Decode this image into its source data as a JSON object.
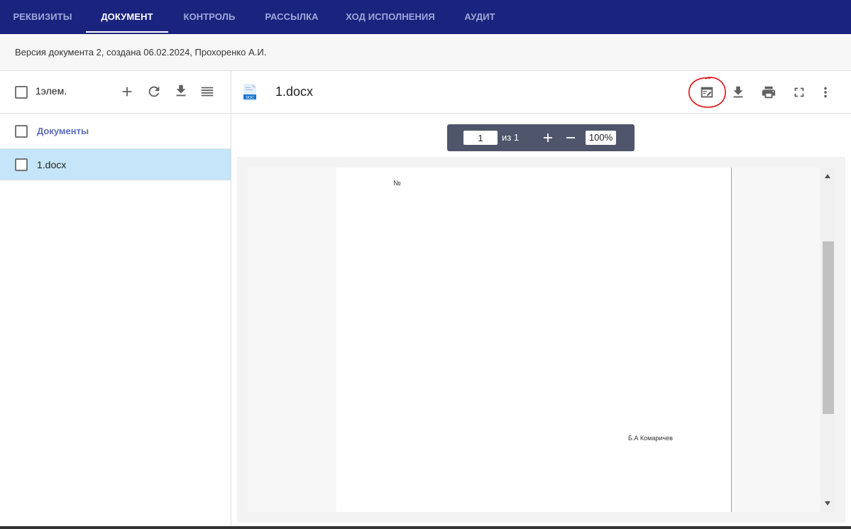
{
  "tabs": [
    {
      "label": "Реквизиты",
      "active": false
    },
    {
      "label": "Документ",
      "active": true
    },
    {
      "label": "Контроль",
      "active": false
    },
    {
      "label": "Рассылка",
      "active": false
    },
    {
      "label": "Ход исполнения",
      "active": false
    },
    {
      "label": "Аудит",
      "active": false
    }
  ],
  "version_info": "Версия документа 2, создана 06.02.2024, Прохоренко А.И.",
  "left_panel": {
    "count_label": "1элем.",
    "toolbar_icons": [
      "add-icon",
      "refresh-icon",
      "download-icon",
      "menu-icon"
    ],
    "group_label": "Документы",
    "items": [
      {
        "label": "1.docx",
        "selected": true
      }
    ]
  },
  "viewer": {
    "file_icon": "doc-file-icon",
    "file_icon_text": "DOC",
    "title": "1.docx",
    "header_icons": [
      "edit-document-icon",
      "download-icon",
      "print-icon",
      "fullscreen-icon",
      "more-vert-icon"
    ],
    "toolbar": {
      "page_current": "1",
      "page_of": "из 1",
      "zoom": "100%"
    },
    "page_content": {
      "number_sign": "№",
      "signature": "Б.А Комаричев"
    }
  },
  "colors": {
    "topbar": "#1a237e",
    "tab_inactive": "#9fa8da",
    "selected_row": "#c5e6f8",
    "group_label": "#5c6bc0",
    "annotation_circle": "#e01010"
  }
}
